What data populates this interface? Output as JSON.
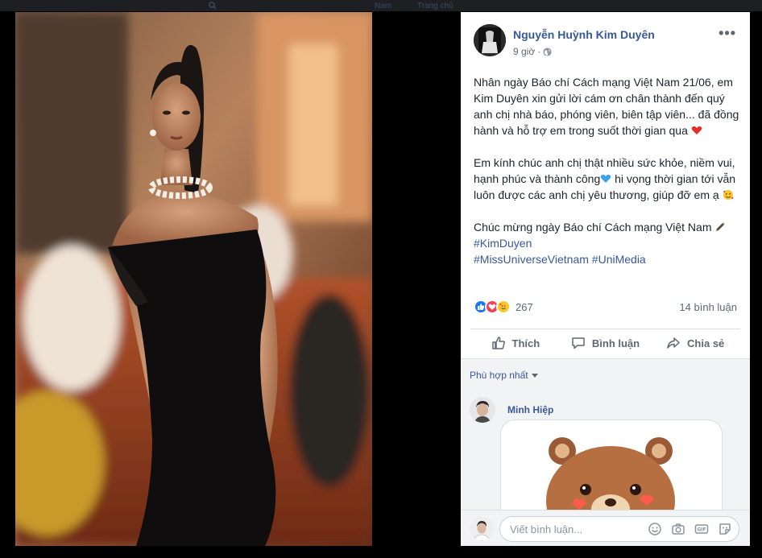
{
  "topbar": {
    "ghost_items": [
      "Nam",
      "Trang chủ"
    ]
  },
  "post": {
    "author": "Nguyễn Huỳnh Kim Duyên",
    "time": "9 giờ",
    "more_label": "•••",
    "paragraph1": "Nhân ngày Báo chí Cách mạng Việt Nam 21/06, em Kim Duyên xin gửi lời cám ơn chân thành đến quý anh chị nhà báo, phóng viên, biên tập viên... đã đồng hành và hỗ trợ em trong suốt thời gian qua",
    "paragraph2_a": "Em kính chúc anh chị thật nhiều sức khỏe, niềm vui, hạnh phúc và thành công",
    "paragraph2_b": " hi vọng thời gian tới vẫn luôn được các anh chị yêu thương, giúp đỡ em ạ",
    "paragraph3": "Chúc mừng ngày Báo chí Cách mạng Việt Nam",
    "hashtags": [
      "#KimDuyen",
      "#MissUniverseVietnam #UniMedia"
    ],
    "reaction_count": "267",
    "comment_count": "14 bình luận",
    "reaction_icons": [
      "like-icon",
      "love-icon",
      "haha-icon"
    ]
  },
  "actions": {
    "like": "Thích",
    "comment": "Bình luận",
    "share": "Chia sẻ"
  },
  "comments": {
    "sort_label": "Phù hợp nhất",
    "items": [
      {
        "name": "Minh Hiệp",
        "content": "sticker"
      }
    ]
  },
  "composer": {
    "placeholder": "Viết bình luận..."
  },
  "colors": {
    "link": "#385898",
    "text": "#1d2129",
    "muted": "#606770",
    "like": "#1877f2",
    "love": "#f33e58"
  }
}
